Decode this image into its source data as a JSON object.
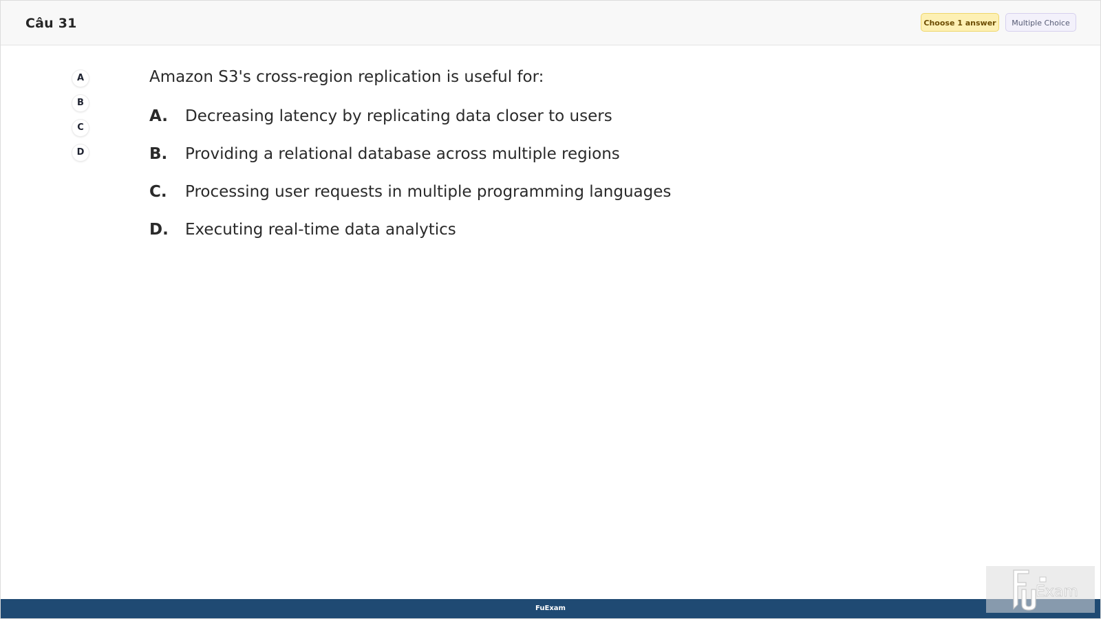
{
  "header": {
    "question_number": "Câu 31",
    "choose_badge": "Choose 1 answer",
    "type_badge": "Multiple Choice"
  },
  "answer_nav": [
    {
      "label": "A"
    },
    {
      "label": "B"
    },
    {
      "label": "C"
    },
    {
      "label": "D"
    }
  ],
  "question": {
    "text": "Amazon S3's cross-region replication is useful for:",
    "options": [
      {
        "letter": "A.",
        "text": "Decreasing latency by replicating data closer to users"
      },
      {
        "letter": "B.",
        "text": "Providing a relational database across multiple regions"
      },
      {
        "letter": "C.",
        "text": "Processing user requests in multiple programming languages"
      },
      {
        "letter": "D.",
        "text": "Executing real-time data analytics"
      }
    ]
  },
  "footer": {
    "brand": "FuExam"
  },
  "watermark": {
    "logo_text": "FUExam"
  },
  "colors": {
    "footer_bg": "#1f4a73",
    "choose_badge_bg": "#fdf0b4",
    "type_badge_bg": "#f3f1fb"
  }
}
